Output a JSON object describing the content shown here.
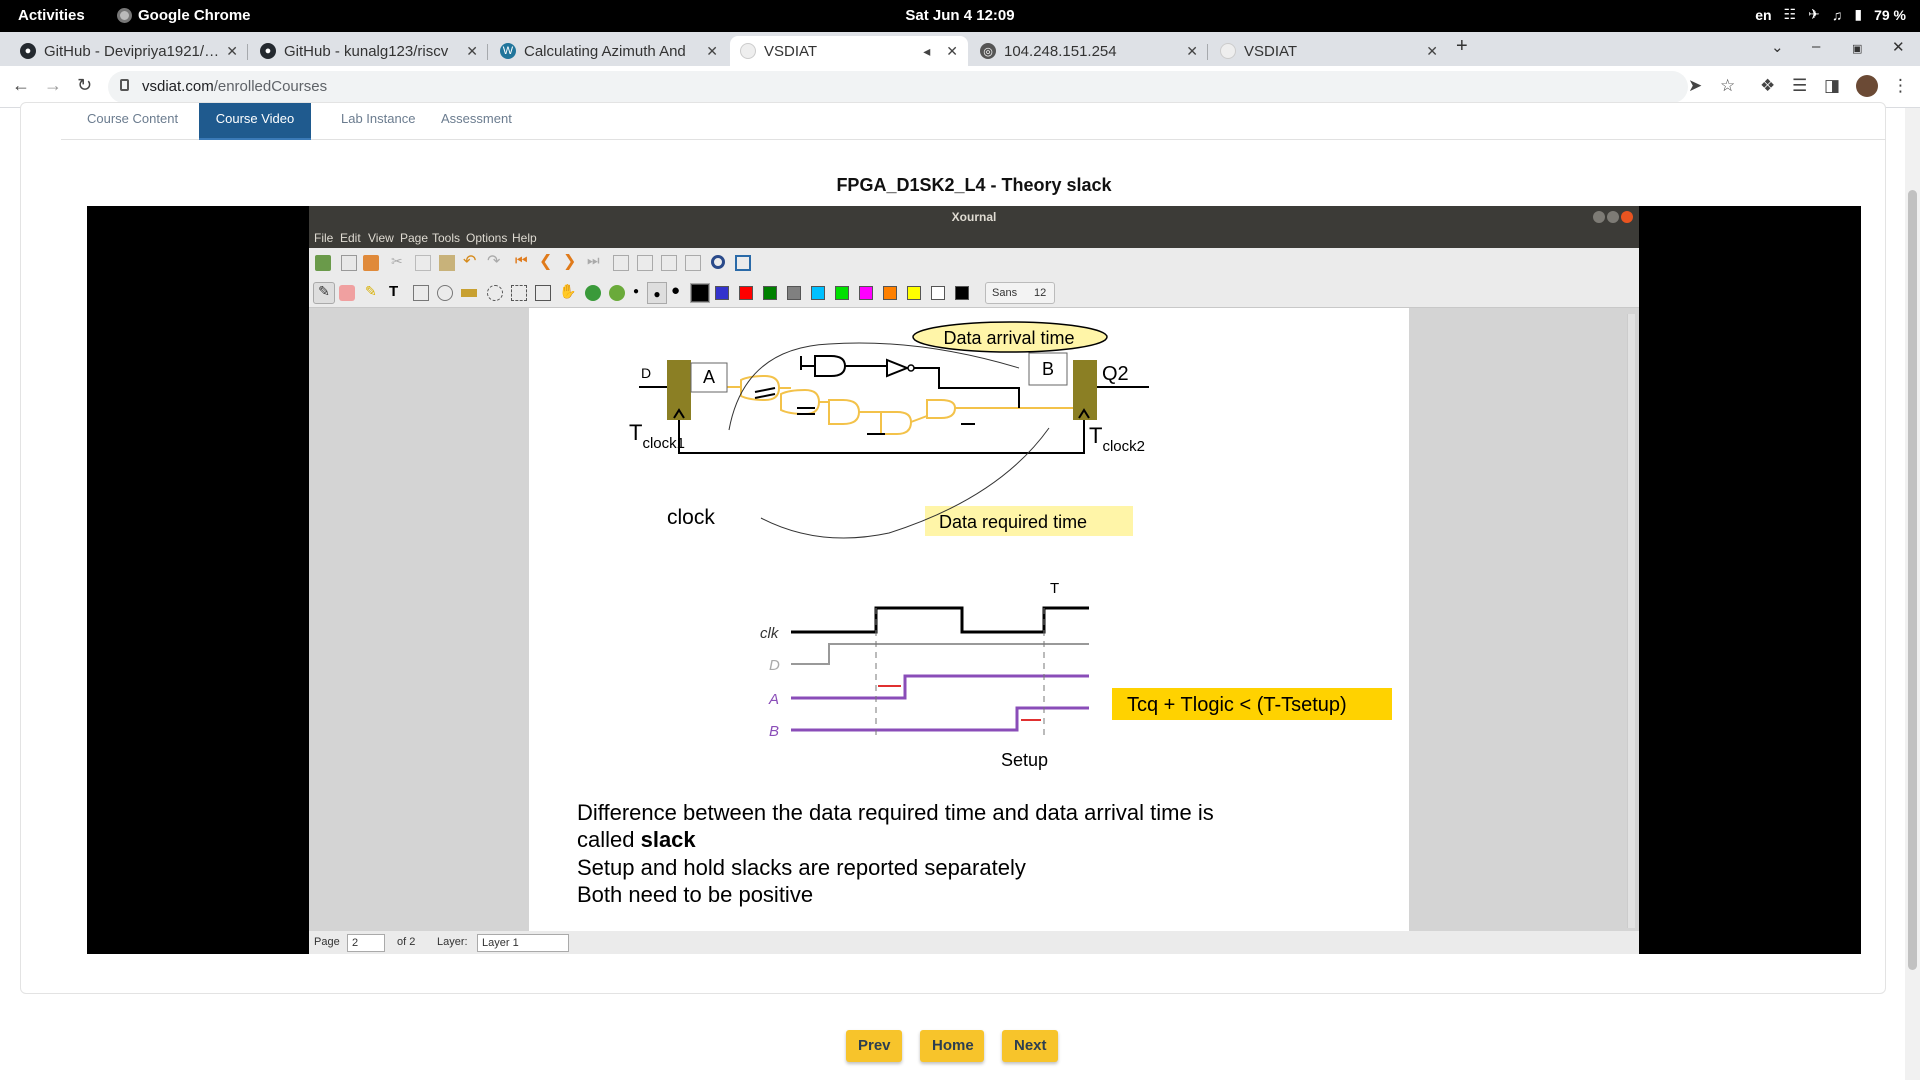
{
  "os_topbar": {
    "activities": "Activities",
    "app_name": "Google Chrome",
    "clock": "Sat Jun 4  12:09",
    "language": "en",
    "battery": "79 %"
  },
  "browser": {
    "tabs": [
      {
        "title": "GitHub - Devipriya1921/…",
        "favicon": "github-icon"
      },
      {
        "title": "GitHub - kunalg123/riscv",
        "favicon": "github-icon"
      },
      {
        "title": "Calculating Azimuth And",
        "favicon": "wordpress-icon"
      },
      {
        "title": "VSDIAT",
        "favicon": "blank-icon",
        "active": true
      },
      {
        "title": "104.248.151.254",
        "favicon": "globe-icon"
      },
      {
        "title": "VSDIAT",
        "favicon": "blank-icon"
      }
    ],
    "address": {
      "domain": "vsdiat.com",
      "path": "/enrolledCourses"
    }
  },
  "course": {
    "tabs": [
      {
        "label": "Course Content"
      },
      {
        "label": "Course Video",
        "active": true
      },
      {
        "label": "Lab Instance"
      },
      {
        "label": "Assessment"
      }
    ],
    "lesson_title": "FPGA_D1SK2_L4 - Theory slack",
    "buttons": {
      "prev": "Prev",
      "home": "Home",
      "next": "Next"
    }
  },
  "xournal": {
    "window_title": "Xournal",
    "menu": [
      "File",
      "Edit",
      "View",
      "Page",
      "Tools",
      "Options",
      "Help"
    ],
    "font_name": "Sans",
    "font_size": "12",
    "pen_colors": [
      "#000000",
      "#3333cc",
      "#ff0000",
      "#008000",
      "#808080",
      "#00c0ff",
      "#00e000",
      "#ff00ff",
      "#ff8000",
      "#ffff00",
      "#ffffff",
      "#000000"
    ],
    "status": {
      "page_label": "Page",
      "page_value": "2",
      "page_of": "of 2",
      "layer_label": "Layer:",
      "layer_value": "Layer 1"
    }
  },
  "slide": {
    "circuit": {
      "D": "D",
      "Q2": "Q2",
      "A": "A",
      "B": "B",
      "clock": "clock",
      "tclock1_main": "T",
      "tclock1_sub": "clock1",
      "tclock2_main": "T",
      "tclock2_sub": "clock2",
      "data_arrival": "Data arrival time",
      "data_required": "Data required time"
    },
    "timing": {
      "clk": "clk",
      "D": "D",
      "A": "A",
      "B": "B",
      "T": "T",
      "setup": "Setup",
      "equation": "Tcq + Tlogic < (T-Tsetup)"
    },
    "text": {
      "line1": "Difference between the data required time and data arrival time is",
      "line2_prefix": "called ",
      "line2_bold": "slack",
      "line3": "Setup and hold slacks are reported separately",
      "line4": "Both need to be positive"
    }
  }
}
